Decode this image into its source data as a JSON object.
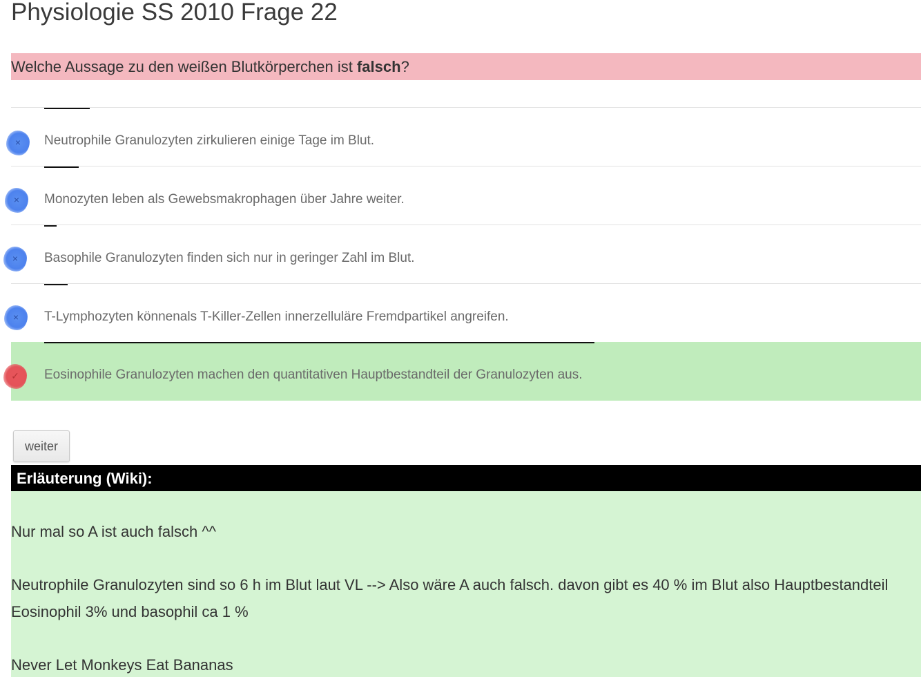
{
  "page": {
    "title": "Physiologie SS 2010 Frage 22"
  },
  "question": {
    "text_before": "Welche Aussage zu den weißen Blutkörperchen ist ",
    "text_bold": "falsch",
    "text_after": "?"
  },
  "answers": [
    {
      "text": "Neutrophile Granulozyten zirkulieren einige Tage im Blut.",
      "mark": "×",
      "state": "wrong",
      "marker_color": "blue"
    },
    {
      "text": "Monozyten leben als Gewebsmakrophagen über Jahre weiter.",
      "mark": "×",
      "state": "wrong",
      "marker_color": "blue"
    },
    {
      "text": "Basophile Granulozyten finden sich nur in geringer Zahl im Blut.",
      "mark": "×",
      "state": "wrong",
      "marker_color": "blue"
    },
    {
      "text": "T-Lymphozyten könnenals T-Killer-Zellen innerzelluläre Fremdpartikel angreifen.",
      "mark": "×",
      "state": "wrong",
      "marker_color": "blue"
    },
    {
      "text": "Eosinophile Granulozyten machen den quantitativen Hauptbestandteil der Granulozyten aus.",
      "mark": "✓",
      "state": "correct",
      "marker_color": "red"
    }
  ],
  "buttons": {
    "next_label": "weiter"
  },
  "wiki": {
    "header": "Erläuterung (Wiki):",
    "paragraphs": [
      "Nur mal so A ist auch falsch ^^",
      "Neutrophile Granulozyten sind so 6 h im Blut laut VL --> Also wäre A auch falsch. davon gibt es 40 % im Blut also Hauptbestandteil",
      "Eosinophil 3% und basophil ca 1 %",
      "Never Let Monkeys Eat Bananas"
    ]
  },
  "colors": {
    "question_bg": "#f4b8bf",
    "correct_bg": "#c0ecbc",
    "wiki_bg": "#d5f4d3",
    "wiki_header_bg": "#000000",
    "blue_marker": "#4d82ee",
    "red_marker": "#e45359"
  }
}
